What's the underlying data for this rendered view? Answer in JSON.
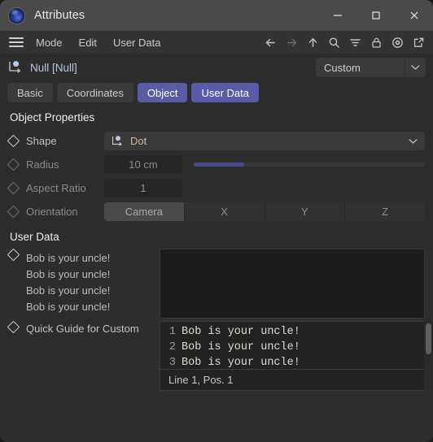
{
  "titlebar": {
    "app_icon": "cinema4d-sphere-icon",
    "title": "Attributes",
    "minimize": "minimize-icon",
    "maximize": "maximize-icon",
    "close": "close-icon"
  },
  "menubar": {
    "hamburger": "hamburger-menu-icon",
    "items": [
      {
        "label": "Mode"
      },
      {
        "label": "Edit"
      },
      {
        "label": "User Data"
      }
    ],
    "icons": [
      {
        "name": "back-arrow-icon",
        "enabled": true
      },
      {
        "name": "forward-arrow-icon",
        "enabled": false
      },
      {
        "name": "up-arrow-icon",
        "enabled": true
      },
      {
        "name": "search-icon",
        "enabled": true
      },
      {
        "name": "filter-icon",
        "enabled": true
      },
      {
        "name": "lock-icon",
        "enabled": true
      },
      {
        "name": "record-target-icon",
        "enabled": true
      },
      {
        "name": "open-external-icon",
        "enabled": true
      }
    ]
  },
  "object_header": {
    "icon": "null-object-icon",
    "name": "Null [Null]",
    "layout_select": {
      "value": "Custom",
      "arrow": "chevron-down-icon"
    }
  },
  "tabs": [
    {
      "label": "Basic",
      "active": false
    },
    {
      "label": "Coordinates",
      "active": false
    },
    {
      "label": "Object",
      "active": true
    },
    {
      "label": "User Data",
      "active": true
    }
  ],
  "object_properties": {
    "heading": "Object Properties",
    "shape": {
      "label": "Shape",
      "value": "Dot",
      "icon": "null-object-icon",
      "arrow": "chevron-down-icon"
    },
    "radius": {
      "label": "Radius",
      "value": "10 cm",
      "slider_percent": 22
    },
    "aspect_ratio": {
      "label": "Aspect Ratio",
      "value": "1"
    },
    "orientation": {
      "label": "Orientation",
      "options": [
        {
          "label": "Camera",
          "active": true
        },
        {
          "label": "X",
          "active": false
        },
        {
          "label": "Y",
          "active": false
        },
        {
          "label": "Z",
          "active": false
        }
      ]
    }
  },
  "user_data": {
    "heading": "User Data",
    "text_entry": {
      "lines": [
        "Bob is your uncle!",
        "Bob is your uncle!",
        "Bob is your uncle!",
        "Bob is your uncle!"
      ],
      "textarea_value": ""
    },
    "quick_guide": {
      "label": "Quick Guide for Custom",
      "code_lines": [
        {
          "num": "1",
          "text": "Bob is your uncle!"
        },
        {
          "num": "2",
          "text": "Bob is your uncle!"
        },
        {
          "num": "3",
          "text": "Bob is your uncle!"
        }
      ],
      "status": "Line 1, Pos. 1"
    }
  },
  "colors": {
    "accent": "#5a5aa8",
    "titlebar": "#4a4a4a",
    "panel": "#2d2d2d",
    "slider_fill": "#4a4a8e"
  }
}
